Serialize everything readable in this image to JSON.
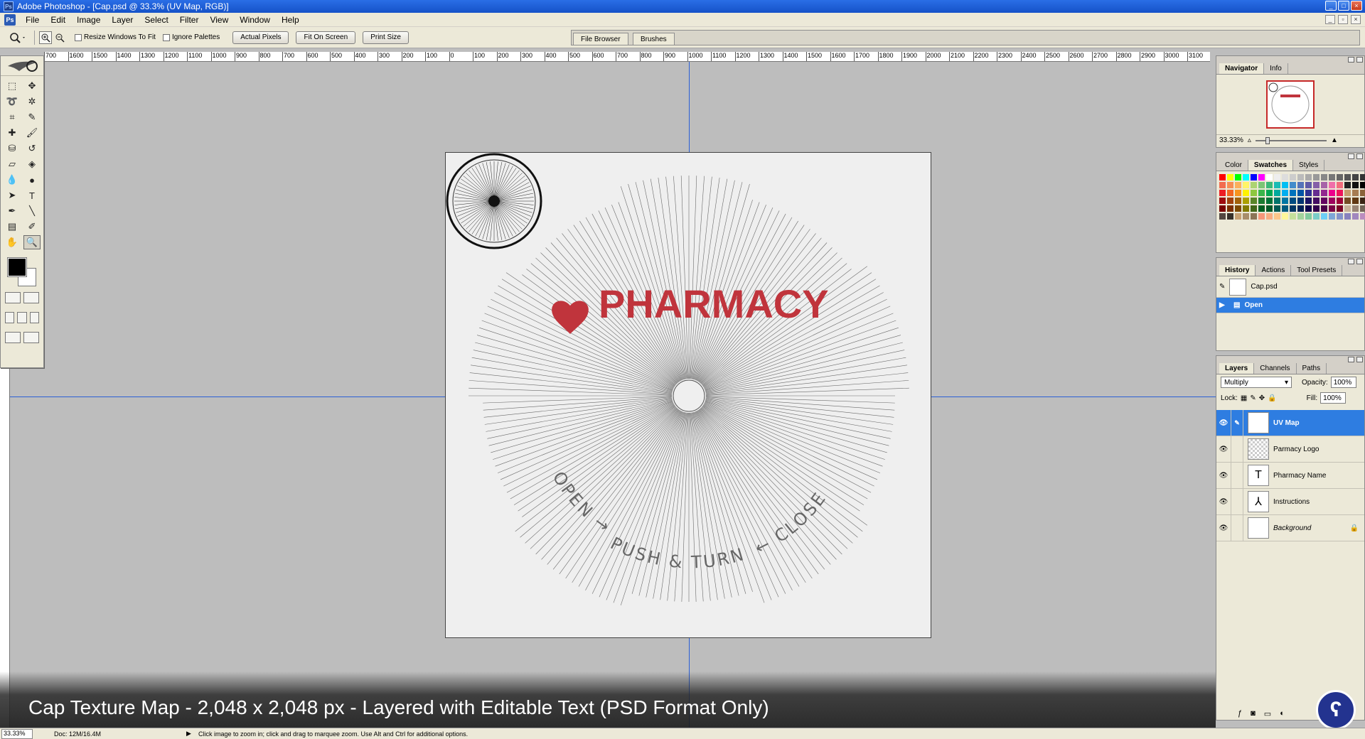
{
  "window": {
    "title": "Adobe Photoshop - [Cap.psd @ 33.3% (UV Map, RGB)]",
    "controls": [
      "_",
      "□",
      "×"
    ],
    "doc_controls": [
      "_",
      "▫",
      "×"
    ]
  },
  "menu": [
    "File",
    "Edit",
    "Image",
    "Layer",
    "Select",
    "Filter",
    "View",
    "Window",
    "Help"
  ],
  "options": {
    "resize_label": "Resize Windows To Fit",
    "ignore_label": "Ignore Palettes",
    "actual_pixels": "Actual Pixels",
    "fit_on_screen": "Fit On Screen",
    "print_size": "Print Size",
    "well_tabs": [
      "File Browser",
      "Brushes"
    ]
  },
  "ruler_labels": [
    "700",
    "1600",
    "1500",
    "1400",
    "1300",
    "1200",
    "1100",
    "1000",
    "900",
    "800",
    "700",
    "600",
    "500",
    "400",
    "300",
    "200",
    "100",
    "0",
    "100",
    "200",
    "300",
    "400",
    "500",
    "600",
    "700",
    "800",
    "900",
    "1000",
    "1100",
    "1200",
    "1300",
    "1400",
    "1500",
    "1600",
    "1700",
    "1800",
    "1900",
    "2000",
    "2100",
    "2200",
    "2300",
    "2400",
    "2500",
    "2600",
    "2700",
    "2800",
    "2900",
    "3000",
    "3100",
    "320"
  ],
  "canvas": {
    "logo_text": "PHARMACY",
    "left_arc_text": "OPEN →",
    "bottom_arc_text": "PUSH & TURN",
    "right_arc_text": "← CLOSE",
    "brand_color": "#c0343c"
  },
  "navigator": {
    "tabs": [
      "Navigator",
      "Info"
    ],
    "zoom": "33.33%"
  },
  "color_panel": {
    "tabs": [
      "Color",
      "Swatches",
      "Styles"
    ],
    "swatches": [
      "#ff0000",
      "#ffff00",
      "#00ff00",
      "#00ffff",
      "#0000ff",
      "#ff00ff",
      "#ffffff",
      "#eeeeee",
      "#dddddd",
      "#cccccc",
      "#bbbbbb",
      "#aaaaaa",
      "#999999",
      "#888888",
      "#777777",
      "#666666",
      "#555555",
      "#444444",
      "#333333",
      "#f26c4f",
      "#f68e55",
      "#fbaf5c",
      "#fff467",
      "#acd372",
      "#7cc576",
      "#3bb878",
      "#1abbb4",
      "#00bff3",
      "#438ccb",
      "#5574b9",
      "#605ca8",
      "#855fa8",
      "#a763a8",
      "#f06ea9",
      "#f26d7d",
      "#222222",
      "#111111",
      "#000000",
      "#ed1c24",
      "#f26522",
      "#f7941d",
      "#fff200",
      "#8dc73f",
      "#39b54a",
      "#00a651",
      "#00a99d",
      "#00aeef",
      "#0072bc",
      "#0054a6",
      "#2e3192",
      "#662d91",
      "#92278f",
      "#ec008c",
      "#ed145b",
      "#c69c6d",
      "#a67c52",
      "#8c6239",
      "#9e0b0f",
      "#a0410d",
      "#a36209",
      "#aba000",
      "#598527",
      "#1a7b30",
      "#007236",
      "#00746b",
      "#0076a3",
      "#004b80",
      "#003471",
      "#1b1464",
      "#440e62",
      "#630460",
      "#9e005d",
      "#9e0039",
      "#754c24",
      "#603913",
      "#3c2415",
      "#790000",
      "#7b2e00",
      "#7d4900",
      "#827b00",
      "#406618",
      "#005e20",
      "#005826",
      "#005952",
      "#005b7f",
      "#003663",
      "#002157",
      "#0d004c",
      "#32004b",
      "#4b0049",
      "#7b0046",
      "#7a0026",
      "#c7b299",
      "#998675",
      "#736357",
      "#534741",
      "#37302a",
      "#c7a174",
      "#a98e6b",
      "#8c7457",
      "#f7977a",
      "#f9ad81",
      "#fdc68a",
      "#fff79a",
      "#c4df9b",
      "#a3d39c",
      "#82ca9d",
      "#7bcdc8",
      "#6ecff6",
      "#7ea7d8",
      "#8493ca",
      "#8882be",
      "#a187be",
      "#bc8dbf"
    ]
  },
  "history": {
    "tabs": [
      "History",
      "Actions",
      "Tool Presets"
    ],
    "snapshot": "Cap.psd",
    "items": [
      "Open"
    ]
  },
  "layers_panel": {
    "tabs": [
      "Layers",
      "Channels",
      "Paths"
    ],
    "blend_mode": "Multiply",
    "opacity_label": "Opacity:",
    "opacity": "100%",
    "lock_label": "Lock:",
    "fill_label": "Fill:",
    "fill": "100%",
    "layers": [
      {
        "name": "UV Map",
        "selected": true
      },
      {
        "name": "Parmacy Logo",
        "selected": false
      },
      {
        "name": "Pharmacy Name",
        "selected": false
      },
      {
        "name": "Instructions",
        "selected": false
      },
      {
        "name": "Background",
        "selected": false
      }
    ]
  },
  "status": {
    "zoom": "33.33%",
    "doc": "Doc: 12M/16.4M",
    "hint": "Click image to zoom in; click and drag to marquee zoom.  Use Alt and Ctrl for additional options."
  },
  "overlay_caption": "Cap Texture Map - 2,048 x 2,048 px - Layered with Editable Text (PSD Format Only)"
}
